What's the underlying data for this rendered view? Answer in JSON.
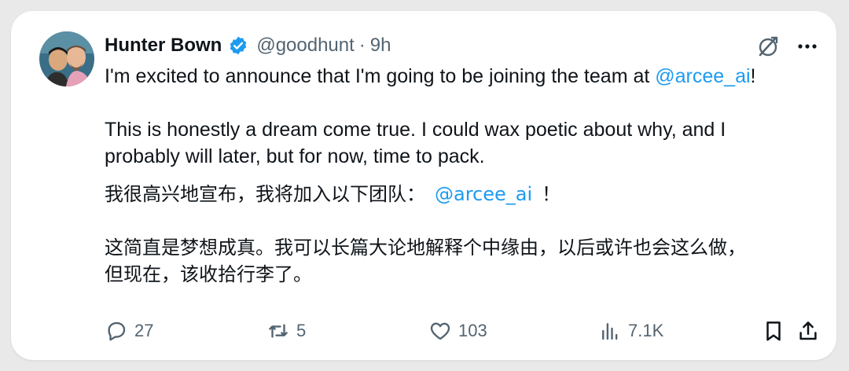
{
  "author": {
    "name": "Hunter Bown",
    "handle": "@goodhunt",
    "separator": "·",
    "time": "9h"
  },
  "tweet": {
    "line1_text": "I'm excited to announce that I'm going to be joining the team at ",
    "line1_mention": "@arcee_ai",
    "line1_end": "!",
    "para2_line1": "This is honestly a dream come true. I could wax poetic about why, and I",
    "para2_line2": "probably will later, but for now, time to pack.",
    "cjk_line1_text": "我很高兴地宣布，我将加入以下团队：",
    "cjk_line1_mention": "@arcee_ai",
    "cjk_line1_end": "！",
    "cjk_para2_line1": "这简直是梦想成真。我可以长篇大论地解释个中缘由，以后或许也会这么做，",
    "cjk_para2_line2": "但现在，该收拾行李了。"
  },
  "stats": {
    "replies": "27",
    "reposts": "5",
    "likes": "103",
    "views": "7.1K"
  },
  "icons": {
    "verified": "verified-badge-icon",
    "grok": "grok-icon",
    "more": "more-icon",
    "reply": "reply-icon",
    "repost": "repost-icon",
    "like": "heart-icon",
    "views": "views-icon",
    "bookmark": "bookmark-icon",
    "share": "share-icon"
  },
  "colors": {
    "accent": "#1d9bf0",
    "text": "#0f1419",
    "muted": "#536471"
  }
}
